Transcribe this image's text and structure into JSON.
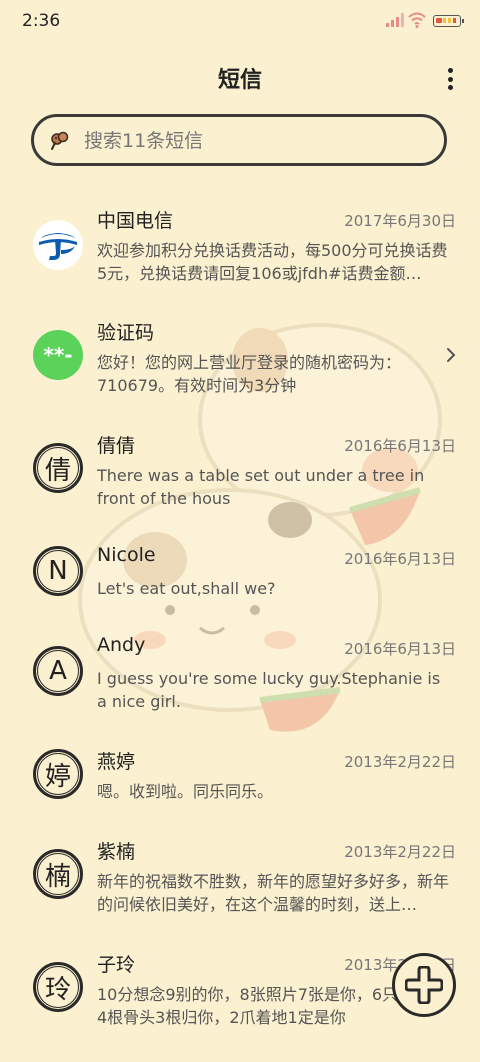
{
  "status_bar": {
    "time": "2:36"
  },
  "header": {
    "title": "短信"
  },
  "search": {
    "placeholder": "搜索11条短信"
  },
  "conversations": [
    {
      "name": "中国电信",
      "date": "2017年6月30日",
      "snippet": "欢迎参加积分兑换话费活动，每500分可兑换话费5元，兑换话费请回复106或jfdh#话费金额…",
      "avatar": "telecom-logo"
    },
    {
      "name": "验证码",
      "date": "",
      "snippet": "您好！您的网上营业厅登录的随机密码为：710679。有效时间为3分钟",
      "avatar_text": "**-"
    },
    {
      "name": "倩倩",
      "date": "2016年6月13日",
      "snippet": "There was a table set out under a tree in front of the hous",
      "avatar_text": "倩"
    },
    {
      "name": "Nicole",
      "date": "2016年6月13日",
      "snippet": "Let's eat out,shall we?",
      "avatar_text": "N"
    },
    {
      "name": "Andy",
      "date": "2016年6月13日",
      "snippet": "I guess you're some lucky guy.Stephanie is a nice girl.",
      "avatar_text": "A"
    },
    {
      "name": "燕婷",
      "date": "2013年2月22日",
      "snippet": "嗯。收到啦。同乐同乐。",
      "avatar_text": "婷"
    },
    {
      "name": "紫楠",
      "date": "2013年2月22日",
      "snippet": "新年的祝福数不胜数，新年的愿望好多好多，新年的问候依旧美好，在这个温馨的时刻，送上…",
      "avatar_text": "楠"
    },
    {
      "name": "子玲",
      "date": "2013年2月22日",
      "snippet": "10分想念9别的你，8张照片7张是你，6只像你，4根骨头3根归你，2爪着地1定是你",
      "avatar_text": "玲"
    }
  ],
  "colors": {
    "background": "#fbf0cf",
    "verification_avatar": "#5bd35b",
    "telecom_blue": "#0a5bb0"
  }
}
